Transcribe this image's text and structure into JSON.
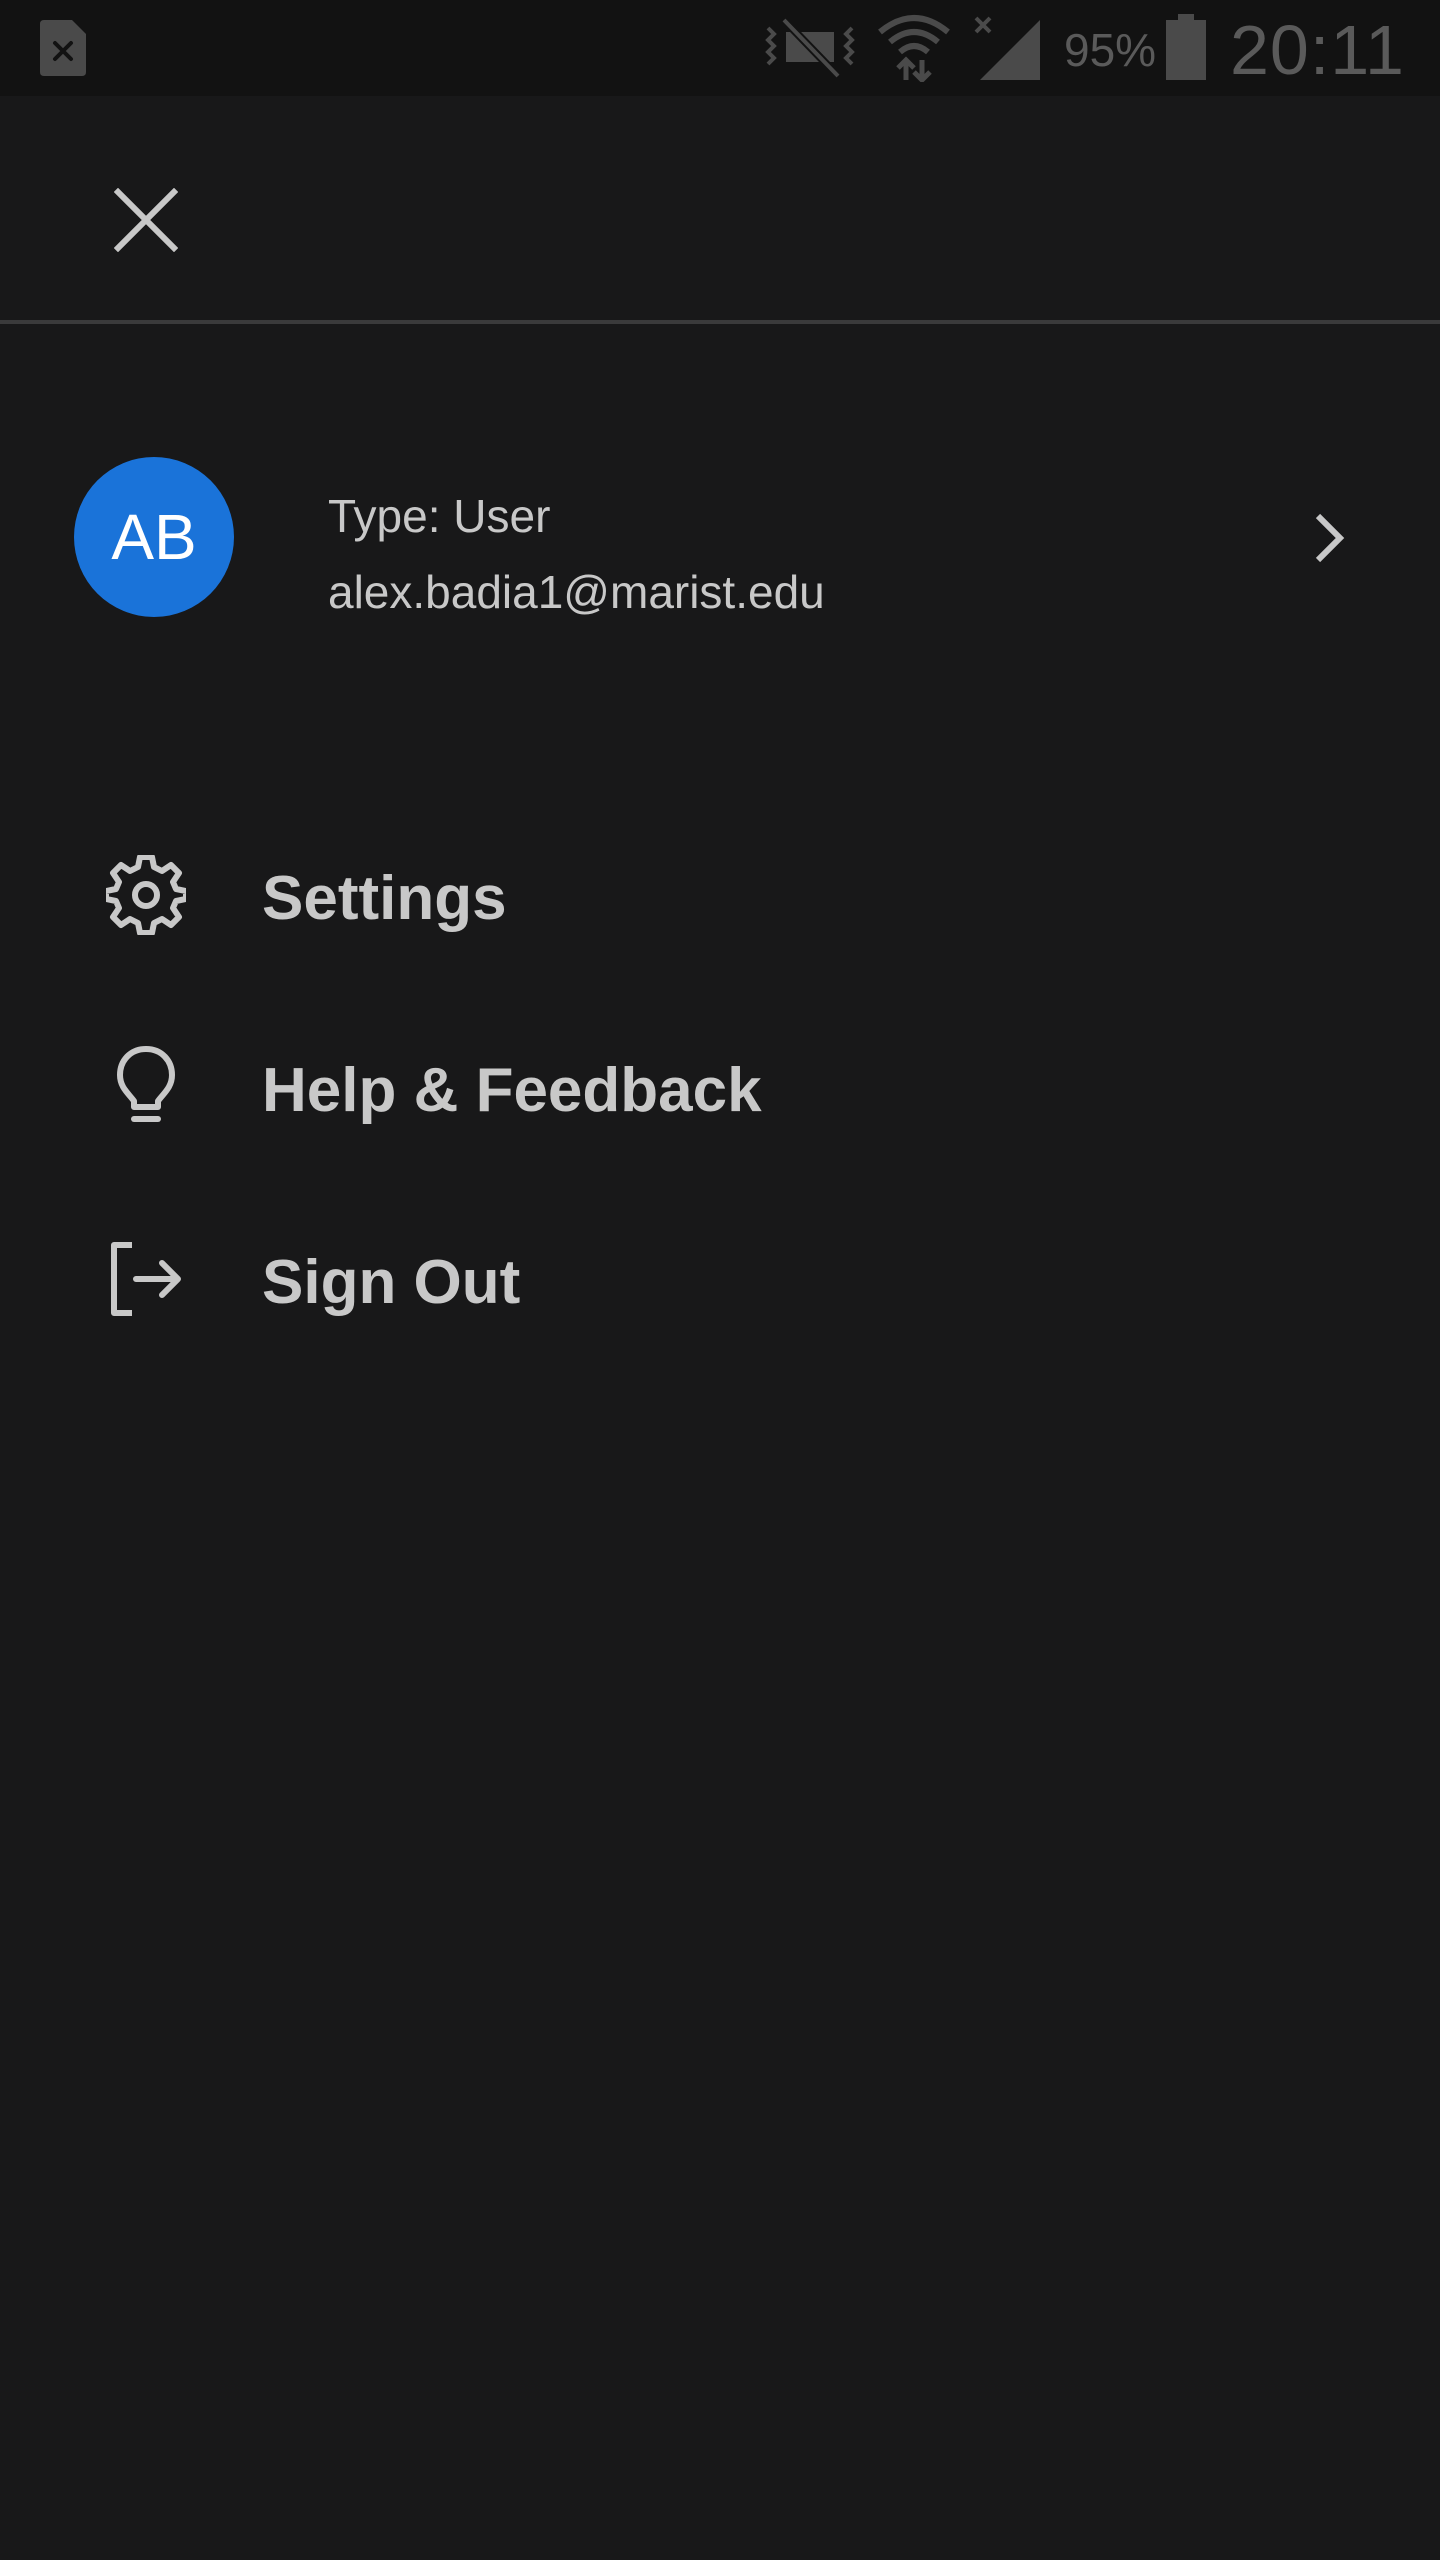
{
  "status_bar": {
    "icons": [
      "sim-card-error-icon",
      "vibrate-mute-icon",
      "wifi-data-icon",
      "signal-no-service-icon",
      "battery-icon"
    ],
    "battery_percent": "95%",
    "time": "20:11"
  },
  "header": {
    "close_icon": "close-icon"
  },
  "account": {
    "avatar_initials": "AB",
    "avatar_color": "#1a73d9",
    "type_label": "Type: User",
    "email": "alex.badia1@marist.edu",
    "chevron_icon": "chevron-right-icon"
  },
  "menu": {
    "items": [
      {
        "label": "Settings",
        "icon": "gear-icon"
      },
      {
        "label": "Help & Feedback",
        "icon": "lightbulb-icon"
      },
      {
        "label": "Sign Out",
        "icon": "sign-out-icon"
      }
    ]
  },
  "colors": {
    "background": "#181819",
    "text": "#c8c8c8",
    "status_bar": "#121212",
    "divider": "#3a3a3b"
  }
}
